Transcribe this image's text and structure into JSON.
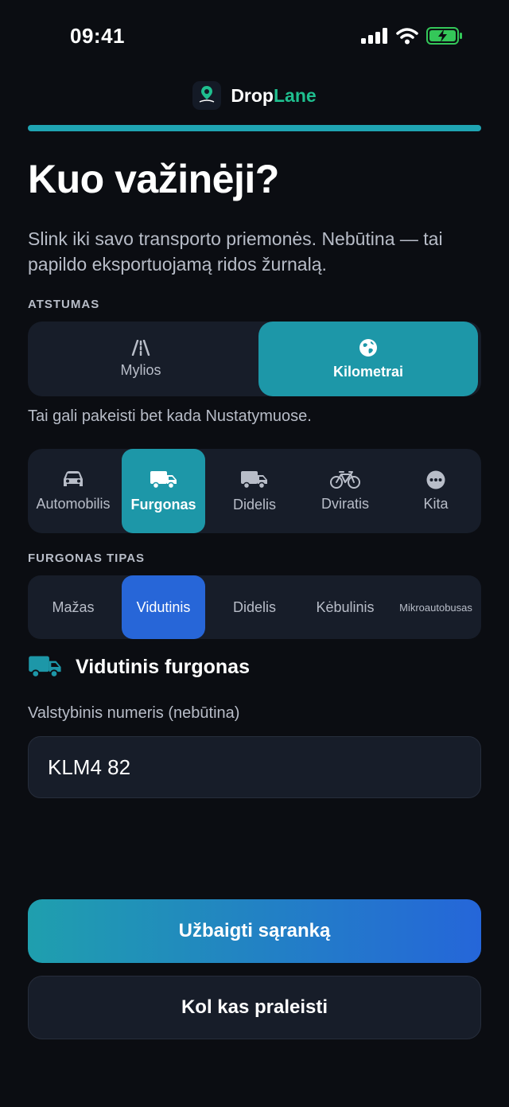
{
  "status": {
    "time": "09:41",
    "icons": [
      "signal-icon",
      "wifi-icon",
      "battery-charging-icon"
    ]
  },
  "brand": {
    "name_part1": "Drop",
    "name_part2": "Lane",
    "logo_text": "Drop Lane",
    "accent_color": "#1fbf8f"
  },
  "progress": {
    "value": 1.0
  },
  "page": {
    "title": "Kuo važinėji?",
    "subtitle": "Slink iki savo transporto priemonės. Nebūtina — tai papildo eksportuojamą ridos žurnalą."
  },
  "distance": {
    "label": "ATSTUMAS",
    "options": [
      {
        "label": "Mylios",
        "icon": "road-icon",
        "selected": false
      },
      {
        "label": "Kilometrai",
        "icon": "globe-icon",
        "selected": true
      }
    ],
    "hint": "Tai gali pakeisti bet kada Nustatymuose."
  },
  "vehicles": {
    "options": [
      {
        "label": "Automobilis",
        "icon": "car-icon",
        "selected": false
      },
      {
        "label": "Furgonas",
        "icon": "van-icon",
        "selected": true
      },
      {
        "label": "Didelis",
        "icon": "truck-icon",
        "selected": false
      },
      {
        "label": "Dviratis",
        "icon": "bicycle-icon",
        "selected": false
      },
      {
        "label": "Kita",
        "icon": "more-icon",
        "selected": false
      }
    ]
  },
  "van_type": {
    "label": "FURGONAS TIPAS",
    "options": [
      {
        "label": "Mažas",
        "selected": false
      },
      {
        "label": "Vidutinis",
        "selected": true
      },
      {
        "label": "Didelis",
        "selected": false
      },
      {
        "label": "Kėbulinis",
        "selected": false
      },
      {
        "label": "Mikroautobusas",
        "selected": false
      }
    ]
  },
  "selected_vehicle": {
    "icon": "van-icon",
    "label": "Vidutinis furgonas"
  },
  "plate": {
    "label": "Valstybinis numeris (nebūtina)",
    "value": "KLM4 82"
  },
  "actions": {
    "primary": "Užbaigti sąranką",
    "secondary": "Kol kas praleisti"
  },
  "colors": {
    "background": "#0b0d12",
    "teal": "#1d97a8",
    "blue": "#2766d8"
  }
}
